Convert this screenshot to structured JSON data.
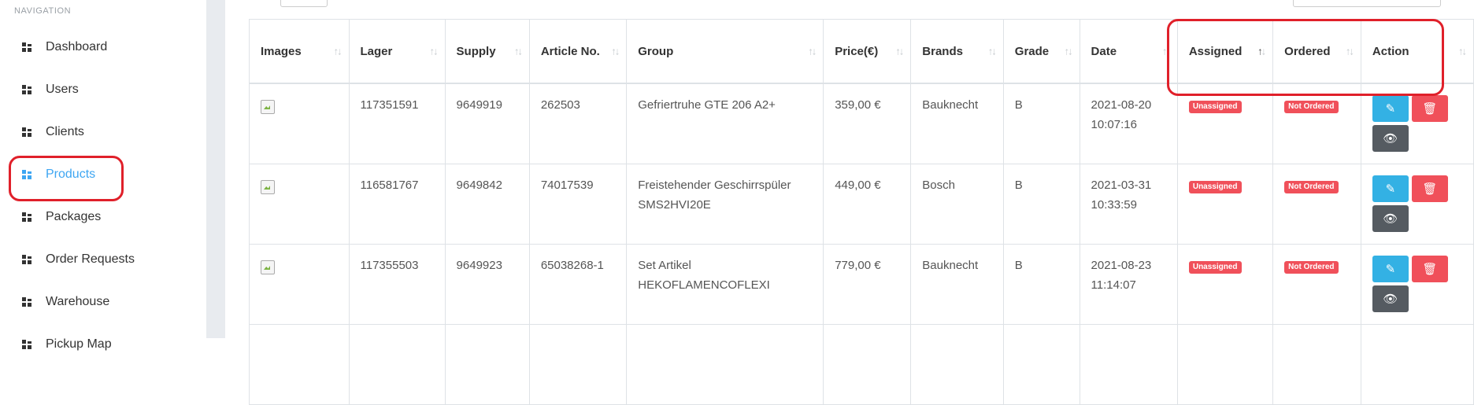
{
  "sidebar": {
    "title": "NAVIGATION",
    "items": [
      {
        "label": "Dashboard"
      },
      {
        "label": "Users"
      },
      {
        "label": "Clients"
      },
      {
        "label": "Products",
        "active": true
      },
      {
        "label": "Packages"
      },
      {
        "label": "Order Requests"
      },
      {
        "label": "Warehouse"
      },
      {
        "label": "Pickup Map"
      }
    ]
  },
  "table": {
    "headers": [
      "Images",
      "Lager",
      "Supply",
      "Article No.",
      "Group",
      "Price(€)",
      "Brands",
      "Grade",
      "Date",
      "Assigned",
      "Ordered",
      "Action"
    ],
    "rows": [
      {
        "lager": "117351591",
        "supply": "9649919",
        "article": "262503",
        "group": "Gefriertruhe GTE 206 A2+",
        "price": "359,00 €",
        "brand": "Bauknecht",
        "grade": "B",
        "date": "2021-08-20 10:07:16",
        "assigned": "Unassigned",
        "ordered": "Not Ordered"
      },
      {
        "lager": "116581767",
        "supply": "9649842",
        "article": "74017539",
        "group": "Freistehender Geschirrspüler SMS2HVI20E",
        "price": "449,00 €",
        "brand": "Bosch",
        "grade": "B",
        "date": "2021-03-31 10:33:59",
        "assigned": "Unassigned",
        "ordered": "Not Ordered"
      },
      {
        "lager": "117355503",
        "supply": "9649923",
        "article": "65038268-1",
        "group": "Set Artikel HEKOFLAMENCOFLEXI",
        "price": "779,00 €",
        "brand": "Bauknecht",
        "grade": "B",
        "date": "2021-08-23 11:14:07",
        "assigned": "Unassigned",
        "ordered": "Not Ordered"
      }
    ]
  },
  "icons": {
    "edit": "edit-icon",
    "delete": "trash-icon",
    "view": "eye-icon",
    "nav": "grid-icon"
  },
  "colors": {
    "accent": "#3ea6f2",
    "danger": "#f0505a",
    "info": "#33b1e4",
    "dark": "#555b61",
    "highlight": "#e0202a"
  }
}
